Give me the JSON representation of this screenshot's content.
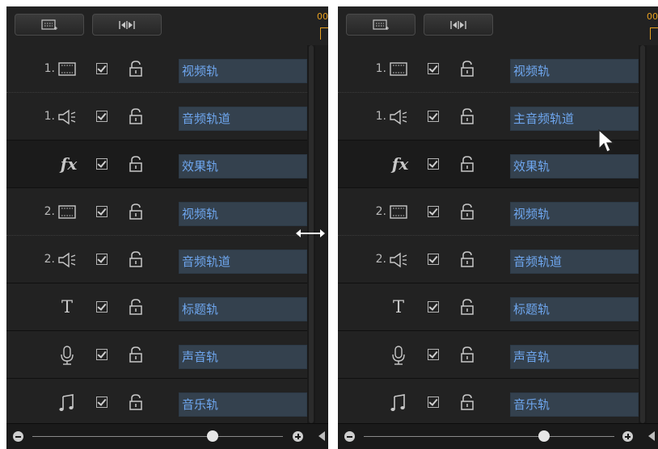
{
  "panels": [
    {
      "tracks": [
        {
          "num": "1.",
          "icon": "video-track-icon",
          "enabled": true,
          "locked": false,
          "name": "视频轨"
        },
        {
          "num": "1.",
          "icon": "audio-track-icon",
          "enabled": true,
          "locked": false,
          "name": "音频轨道"
        },
        {
          "num": "",
          "icon": "fx-effect-icon",
          "enabled": true,
          "locked": false,
          "name": "效果轨"
        },
        {
          "num": "2.",
          "icon": "video-track-icon",
          "enabled": true,
          "locked": false,
          "name": "视频轨"
        },
        {
          "num": "2.",
          "icon": "audio-track-icon",
          "enabled": true,
          "locked": false,
          "name": "音频轨道"
        },
        {
          "num": "",
          "icon": "title-text-icon",
          "enabled": true,
          "locked": false,
          "name": "标题轨"
        },
        {
          "num": "",
          "icon": "microphone-icon",
          "enabled": true,
          "locked": false,
          "name": "声音轨"
        },
        {
          "num": "",
          "icon": "music-note-icon",
          "enabled": true,
          "locked": false,
          "name": "音乐轨"
        }
      ],
      "zoom_level": 0.72
    },
    {
      "tracks": [
        {
          "num": "1.",
          "icon": "video-track-icon",
          "enabled": true,
          "locked": false,
          "name": "视频轨"
        },
        {
          "num": "1.",
          "icon": "audio-track-icon",
          "enabled": true,
          "locked": false,
          "name": "主音频轨道"
        },
        {
          "num": "",
          "icon": "fx-effect-icon",
          "enabled": true,
          "locked": false,
          "name": "效果轨"
        },
        {
          "num": "2.",
          "icon": "video-track-icon",
          "enabled": true,
          "locked": false,
          "name": "视频轨"
        },
        {
          "num": "2.",
          "icon": "audio-track-icon",
          "enabled": true,
          "locked": false,
          "name": "音频轨道"
        },
        {
          "num": "",
          "icon": "title-text-icon",
          "enabled": true,
          "locked": false,
          "name": "标题轨"
        },
        {
          "num": "",
          "icon": "microphone-icon",
          "enabled": true,
          "locked": false,
          "name": "声音轨"
        },
        {
          "num": "",
          "icon": "music-note-icon",
          "enabled": true,
          "locked": false,
          "name": "音乐轨"
        }
      ],
      "zoom_level": 0.72
    }
  ],
  "toolbar": {
    "button1_icon": "add-track-icon",
    "button2_icon": "fit-timeline-icon",
    "timecode_fragment": "00"
  },
  "colors": {
    "panel_bg": "#1d1d1d",
    "name_field_bg": "#34414e",
    "name_text": "#6ea6ee",
    "timecode": "#e8a020"
  },
  "fx_label": "fx",
  "title_glyph": "T"
}
